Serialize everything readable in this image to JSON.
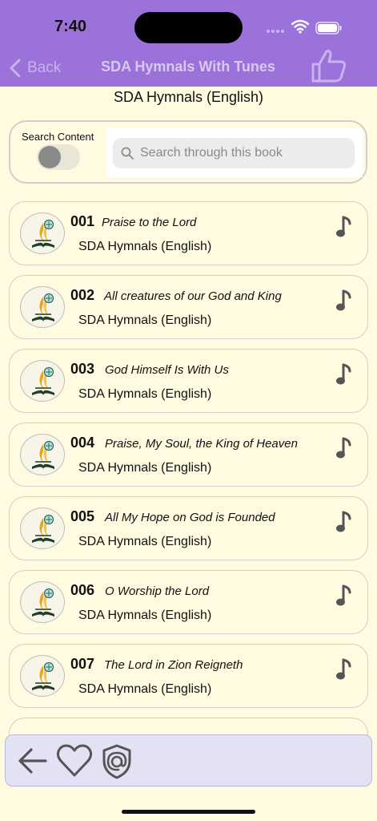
{
  "status": {
    "time": "7:40"
  },
  "nav": {
    "back_label": "Back",
    "title": "SDA Hymnals With Tunes"
  },
  "book_title": "SDA Hymnals (English)",
  "search": {
    "toggle_label": "Search Content",
    "placeholder": "Search through this book",
    "toggle_on": false
  },
  "hymns": [
    {
      "number": "001",
      "title": "Praise to the Lord",
      "book": "SDA Hymnals (English)"
    },
    {
      "number": "002",
      "title": "All creatures of our God and King",
      "book": "SDA Hymnals (English)"
    },
    {
      "number": "003",
      "title": "God Himself Is With Us",
      "book": "SDA Hymnals (English)"
    },
    {
      "number": "004",
      "title": "Praise, My Soul, the King of Heaven",
      "book": "SDA Hymnals (English)"
    },
    {
      "number": "005",
      "title": "All My Hope on God is Founded",
      "book": "SDA Hymnals (English)"
    },
    {
      "number": "006",
      "title": "O Worship the Lord",
      "book": "SDA Hymnals (English)"
    },
    {
      "number": "007",
      "title": "The Lord in Zion Reigneth",
      "book": "SDA Hymnals (English)"
    }
  ],
  "colors": {
    "header": "#9b72d9",
    "background": "#fffbe0",
    "bottom_bar": "#e3e2f4"
  },
  "icons": {
    "nav": [
      "chevron-left-icon",
      "thumbs-up-icon"
    ],
    "row": [
      "sda-logo-icon",
      "music-note-icon"
    ],
    "bottom_bar": [
      "arrow-left-icon",
      "heart-icon",
      "shield-at-icon"
    ]
  }
}
